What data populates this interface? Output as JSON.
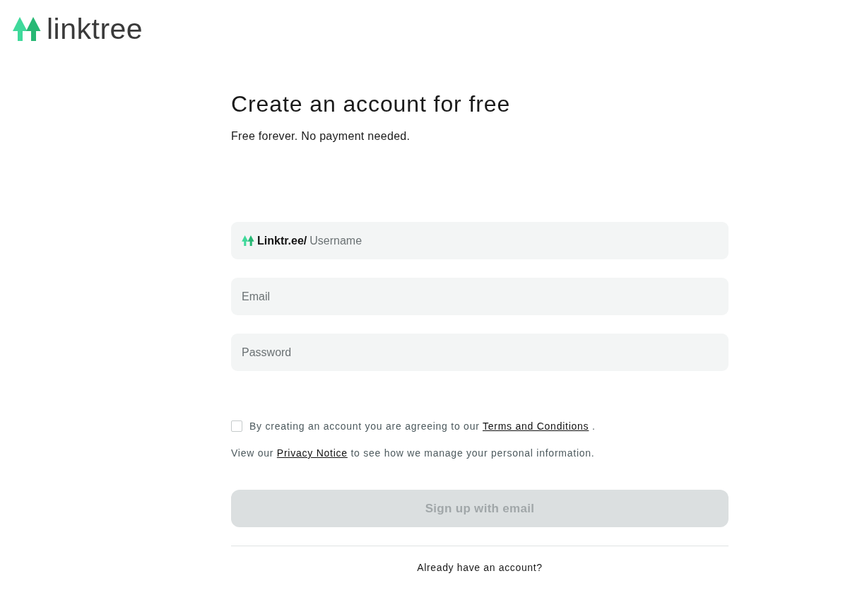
{
  "logo": {
    "wordmark": "linktree"
  },
  "heading": {
    "title": "Create an account for free",
    "subtitle": "Free forever. No payment needed."
  },
  "form": {
    "fields": [
      {
        "kind": "username",
        "prefix": "Linktr.ee/",
        "placeholder": "Username"
      },
      {
        "kind": "email",
        "placeholder": "Email"
      },
      {
        "kind": "password",
        "placeholder": "Password"
      }
    ],
    "terms": {
      "checked": false,
      "text": "By creating an account you are agreeing to our",
      "link": "Terms and Conditions",
      "after": "."
    },
    "privacy": {
      "before": "View our",
      "link": "Privacy Notice",
      "after": "to see how we manage your personal information."
    },
    "submit": {
      "label": "Sign up with email",
      "disabled": true
    },
    "login_prompt": "Already have an account?"
  }
}
